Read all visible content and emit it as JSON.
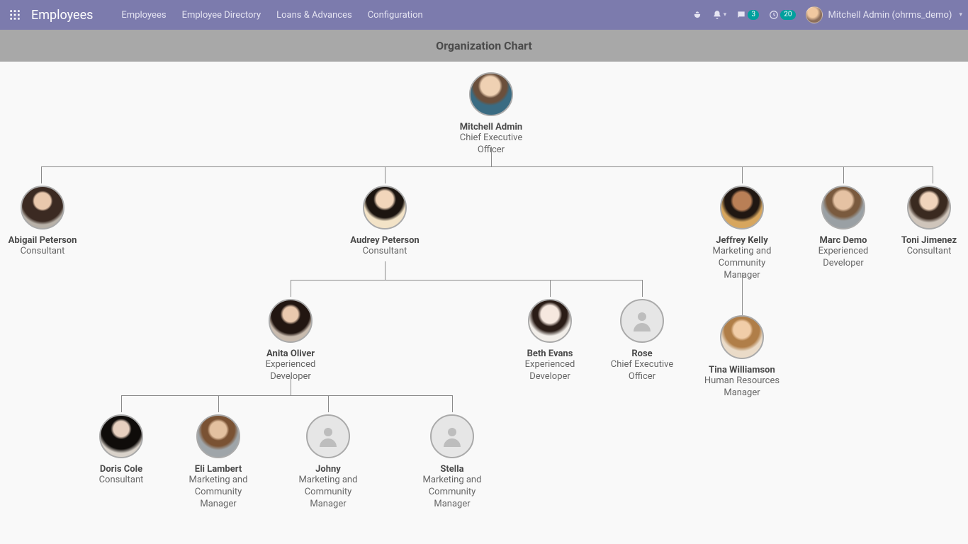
{
  "brand": "Employees",
  "nav": {
    "links": [
      "Employees",
      "Employee Directory",
      "Loans & Advances",
      "Configuration"
    ]
  },
  "badges": {
    "chat": "3",
    "clock": "20"
  },
  "user": {
    "display": "Mitchell Admin (ohrms_demo)"
  },
  "page_title": "Organization Chart",
  "org": {
    "root": {
      "name": "Mitchell Admin",
      "title": "Chief Executive Officer"
    },
    "l2": [
      {
        "name": "Abigail Peterson",
        "title": "Consultant"
      },
      {
        "name": "Audrey Peterson",
        "title": "Consultant"
      },
      {
        "name": "Jeffrey Kelly",
        "title": "Marketing and Community Manager"
      },
      {
        "name": "Marc Demo",
        "title": "Experienced Developer"
      },
      {
        "name": "Toni Jimenez",
        "title": "Consultant"
      }
    ],
    "audrey_children": [
      {
        "name": "Anita Oliver",
        "title": "Experienced Developer"
      },
      {
        "name": "Beth Evans",
        "title": "Experienced Developer"
      },
      {
        "name": "Rose",
        "title": "Chief Executive Officer"
      }
    ],
    "jeffrey_children": [
      {
        "name": "Tina Williamson",
        "title": "Human Resources Manager"
      }
    ],
    "anita_children": [
      {
        "name": "Doris Cole",
        "title": "Consultant"
      },
      {
        "name": "Eli Lambert",
        "title": "Marketing and Community Manager"
      },
      {
        "name": "Johny",
        "title": "Marketing and Community Manager"
      },
      {
        "name": "Stella",
        "title": "Marketing and Community Manager"
      }
    ]
  }
}
